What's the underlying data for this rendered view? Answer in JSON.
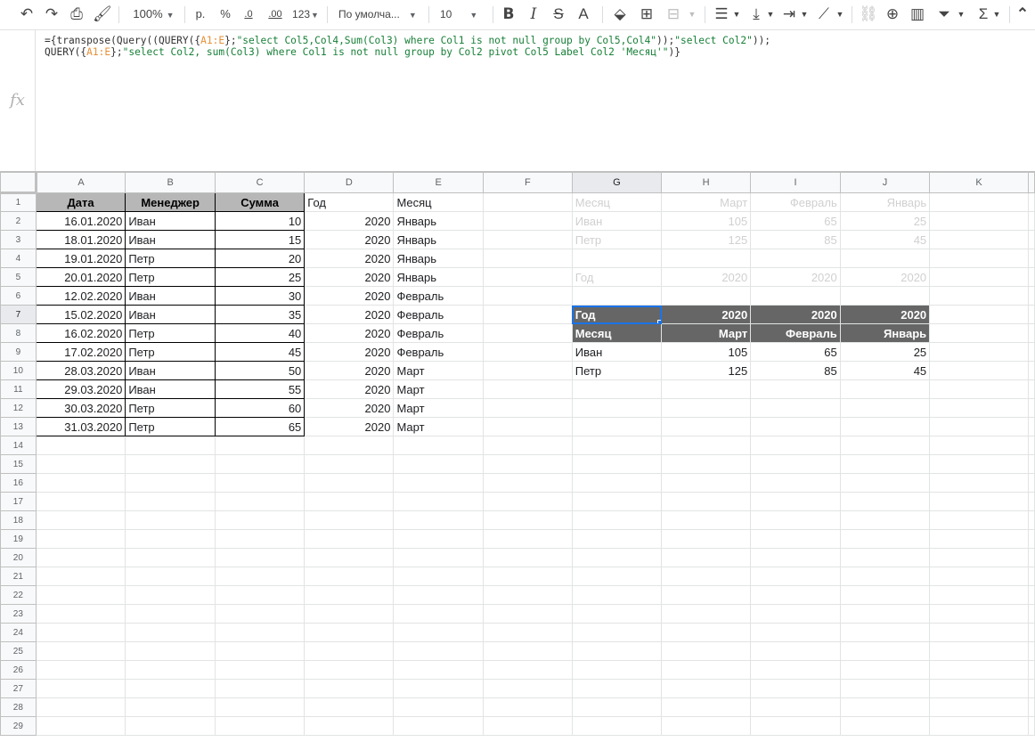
{
  "toolbar": {
    "zoom": "100%",
    "currency": "р.",
    "percent": "%",
    "dec_decrease": ".0",
    "dec_increase": ".00",
    "more_formats": "123",
    "font": "По умолча...",
    "font_size": "10"
  },
  "formula": {
    "line1": [
      {
        "t": "={transpose(Query((QUERY({",
        "c": "plain"
      },
      {
        "t": "A1:E",
        "c": "ref"
      },
      {
        "t": "};",
        "c": "plain"
      },
      {
        "t": "\"select Col5,Col4,Sum(Col3) where Col1 is not null group by Col5,Col4\"",
        "c": "str"
      },
      {
        "t": "));",
        "c": "plain"
      },
      {
        "t": "\"select Col2\"",
        "c": "str"
      },
      {
        "t": "));",
        "c": "plain"
      }
    ],
    "line2": [
      {
        "t": "QUERY({",
        "c": "plain"
      },
      {
        "t": "A1:E",
        "c": "ref"
      },
      {
        "t": "};",
        "c": "plain"
      },
      {
        "t": "\"select Col2, sum(Col3) where Col1 is not null group by Col2 pivot Col5 Label Col2 'Месяц'\"",
        "c": "str"
      },
      {
        "t": ")}",
        "c": "plain"
      }
    ]
  },
  "columns": [
    "A",
    "B",
    "C",
    "D",
    "E",
    "F",
    "G",
    "H",
    "I",
    "J",
    "K"
  ],
  "source_table": {
    "headers": [
      "Дата",
      "Менеджер",
      "Сумма",
      "Год",
      "Месяц"
    ],
    "rows": [
      [
        "16.01.2020",
        "Иван",
        "10",
        "2020",
        "Январь"
      ],
      [
        "18.01.2020",
        "Иван",
        "15",
        "2020",
        "Январь"
      ],
      [
        "19.01.2020",
        "Петр",
        "20",
        "2020",
        "Январь"
      ],
      [
        "20.01.2020",
        "Петр",
        "25",
        "2020",
        "Январь"
      ],
      [
        "12.02.2020",
        "Иван",
        "30",
        "2020",
        "Февраль"
      ],
      [
        "15.02.2020",
        "Иван",
        "35",
        "2020",
        "Февраль"
      ],
      [
        "16.02.2020",
        "Петр",
        "40",
        "2020",
        "Февраль"
      ],
      [
        "17.02.2020",
        "Петр",
        "45",
        "2020",
        "Февраль"
      ],
      [
        "28.03.2020",
        "Иван",
        "50",
        "2020",
        "Март"
      ],
      [
        "29.03.2020",
        "Иван",
        "55",
        "2020",
        "Март"
      ],
      [
        "30.03.2020",
        "Петр",
        "60",
        "2020",
        "Март"
      ],
      [
        "31.03.2020",
        "Петр",
        "65",
        "2020",
        "Март"
      ]
    ]
  },
  "helper_table": {
    "rows": [
      [
        "Месяц",
        "Март",
        "Февраль",
        "Январь"
      ],
      [
        "Иван",
        "105",
        "65",
        "25"
      ],
      [
        "Петр",
        "125",
        "85",
        "45"
      ],
      [
        "",
        "",
        "",
        ""
      ],
      [
        "Год",
        "2020",
        "2020",
        "2020"
      ]
    ]
  },
  "result_table": {
    "rows": [
      [
        "Год",
        "2020",
        "2020",
        "2020"
      ],
      [
        "Месяц",
        "Март",
        "Февраль",
        "Январь"
      ],
      [
        "Иван",
        "105",
        "65",
        "25"
      ],
      [
        "Петр",
        "125",
        "85",
        "45"
      ]
    ]
  },
  "row_count": 29
}
